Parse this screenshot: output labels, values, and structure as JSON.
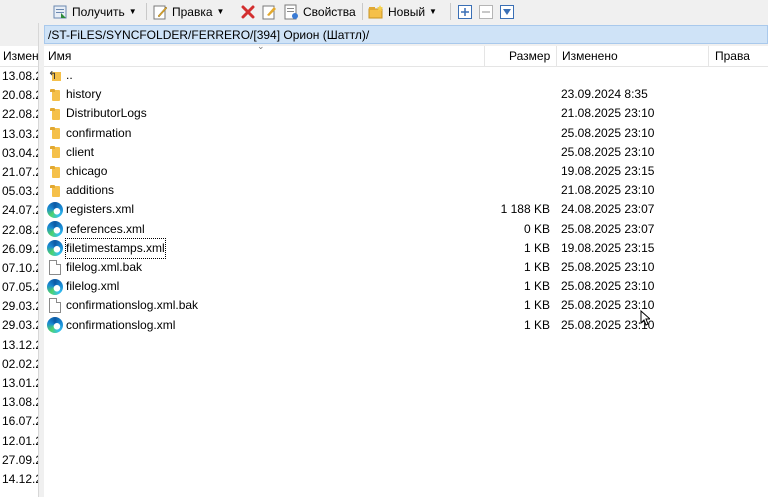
{
  "toolbar": {
    "get_label": "Получить",
    "edit_label": "Правка",
    "properties_label": "Свойства",
    "new_label": "Новый"
  },
  "path": "/ST-FiLES/SYNCFOLDER/FERRERO/[394] Орион (Шаттл)/",
  "left_panel": {
    "header": "Изменен",
    "dates": [
      "13.08.2",
      "20.08.2",
      "22.08.2",
      "13.03.2",
      "03.04.2",
      "21.07.2",
      "05.03.2",
      "24.07.2",
      "22.08.2",
      "26.09.2",
      "07.10.2",
      "07.05.2",
      "29.03.2",
      "29.03.2",
      "13.12.2",
      "02.02.2",
      "13.01.2",
      "13.08.2",
      "16.07.2",
      "12.01.2",
      "27.09.2",
      "14.12.2"
    ]
  },
  "columns": {
    "name": "Имя",
    "size": "Размер",
    "modified": "Изменено",
    "rights": "Права"
  },
  "files": [
    {
      "name": "..",
      "icon": "parent-folder-icon",
      "size": "",
      "modified": ""
    },
    {
      "name": "history",
      "icon": "folder-icon",
      "size": "",
      "modified": "23.09.2024 8:35"
    },
    {
      "name": "DistributorLogs",
      "icon": "folder-icon",
      "size": "",
      "modified": "21.08.2025 23:10"
    },
    {
      "name": "confirmation",
      "icon": "folder-icon",
      "size": "",
      "modified": "25.08.2025 23:10"
    },
    {
      "name": "client",
      "icon": "folder-icon",
      "size": "",
      "modified": "25.08.2025 23:10"
    },
    {
      "name": "chicago",
      "icon": "folder-icon",
      "size": "",
      "modified": "19.08.2025 23:15"
    },
    {
      "name": "additions",
      "icon": "folder-icon",
      "size": "",
      "modified": "21.08.2025 23:10"
    },
    {
      "name": "registers.xml",
      "icon": "edge-icon",
      "size": "1 188 KB",
      "modified": "24.08.2025 23:07"
    },
    {
      "name": "references.xml",
      "icon": "edge-icon",
      "size": "0 KB",
      "modified": "25.08.2025 23:07"
    },
    {
      "name": "filetimestamps.xml",
      "icon": "edge-icon",
      "size": "1 KB",
      "modified": "19.08.2025 23:15"
    },
    {
      "name": "filelog.xml.bak",
      "icon": "document-icon",
      "size": "1 KB",
      "modified": "25.08.2025 23:10"
    },
    {
      "name": "filelog.xml",
      "icon": "edge-icon",
      "size": "1 KB",
      "modified": "25.08.2025 23:10"
    },
    {
      "name": "confirmationslog.xml.bak",
      "icon": "document-icon",
      "size": "1 KB",
      "modified": "25.08.2025 23:10"
    },
    {
      "name": "confirmationslog.xml",
      "icon": "edge-icon",
      "size": "1 KB",
      "modified": "25.08.2025 23:10"
    }
  ],
  "colors": {
    "path_bar": "#cfe3f7",
    "folder": "#f5c04a",
    "delete": "#d32f2f",
    "accent": "#1a6fc4"
  }
}
